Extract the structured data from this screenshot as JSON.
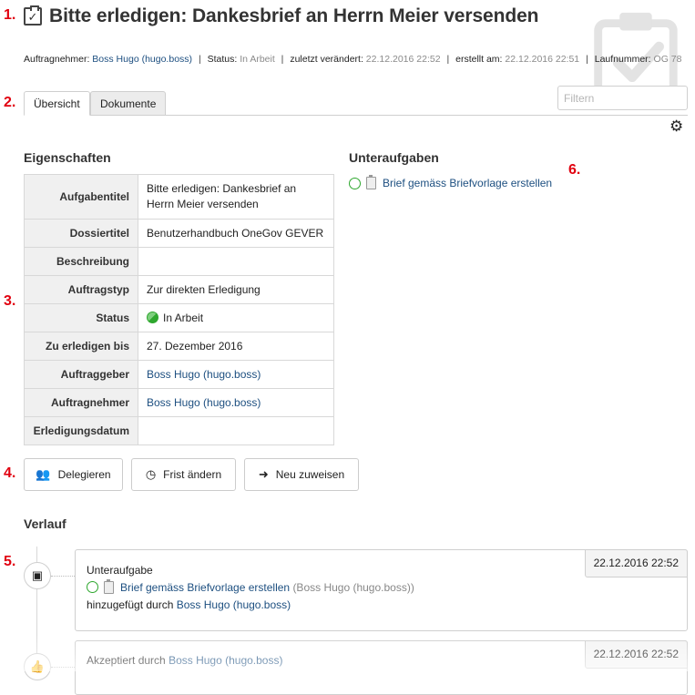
{
  "markers": [
    "1.",
    "2.",
    "3.",
    "4.",
    "5.",
    "6."
  ],
  "header": {
    "title": "Bitte erledigen: Dankesbrief an Herrn Meier versenden",
    "title_icon": "task-checkbox-icon",
    "meta": {
      "assignee_label": "Auftragnehmer:",
      "assignee": "Boss Hugo (hugo.boss)",
      "status_label": "Status:",
      "status": "In Arbeit",
      "modified_label": "zuletzt verändert:",
      "modified": "22.12.2016 22:52",
      "created_label": "erstellt am:",
      "created": "22.12.2016 22:51",
      "sequence_label": "Laufnummer:",
      "sequence": "OG 78"
    }
  },
  "tabs": [
    {
      "label": "Übersicht",
      "active": true
    },
    {
      "label": "Dokumente",
      "active": false
    }
  ],
  "filter": {
    "placeholder": "Filtern"
  },
  "properties": {
    "heading": "Eigenschaften",
    "rows": [
      {
        "key": "Aufgabentitel",
        "value": "Bitte erledigen: Dankesbrief an Herrn Meier versenden"
      },
      {
        "key": "Dossiertitel",
        "value": "Benutzerhandbuch OneGov GEVER"
      },
      {
        "key": "Beschreibung",
        "value": ""
      },
      {
        "key": "Auftragstyp",
        "value": "Zur direkten Erledigung"
      },
      {
        "key": "Status",
        "value": "In Arbeit"
      },
      {
        "key": "Zu erledigen bis",
        "value": "27. Dezember 2016"
      },
      {
        "key": "Auftraggeber",
        "value": "Boss Hugo (hugo.boss)"
      },
      {
        "key": "Auftragnehmer",
        "value": "Boss Hugo (hugo.boss)"
      },
      {
        "key": "Erledigungsdatum",
        "value": ""
      }
    ]
  },
  "subtasks": {
    "heading": "Unteraufgaben",
    "items": [
      {
        "label": "Brief gemäss Briefvorlage erstellen"
      }
    ]
  },
  "actions": [
    {
      "label": "Delegieren",
      "icon": "users-icon"
    },
    {
      "label": "Frist ändern",
      "icon": "clock-icon"
    },
    {
      "label": "Neu zuweisen",
      "icon": "arrow-right-icon"
    }
  ],
  "history": {
    "heading": "Verlauf",
    "entries": [
      {
        "date": "22.12.2016 22:52",
        "title": "Unteraufgabe",
        "task_link": "Brief gemäss Briefvorlage erstellen",
        "task_user": "(Boss Hugo (hugo.boss))",
        "added_by_label": "hinzugefügt durch",
        "added_by": "Boss Hugo (hugo.boss)"
      },
      {
        "date": "22.12.2016 22:52",
        "accepted_label": "Akzeptiert durch",
        "accepted_by": "Boss Hugo (hugo.boss)"
      }
    ]
  },
  "colors": {
    "link": "#1d4f80",
    "marker": "#e1000f",
    "status_green": "#2ea72e"
  }
}
